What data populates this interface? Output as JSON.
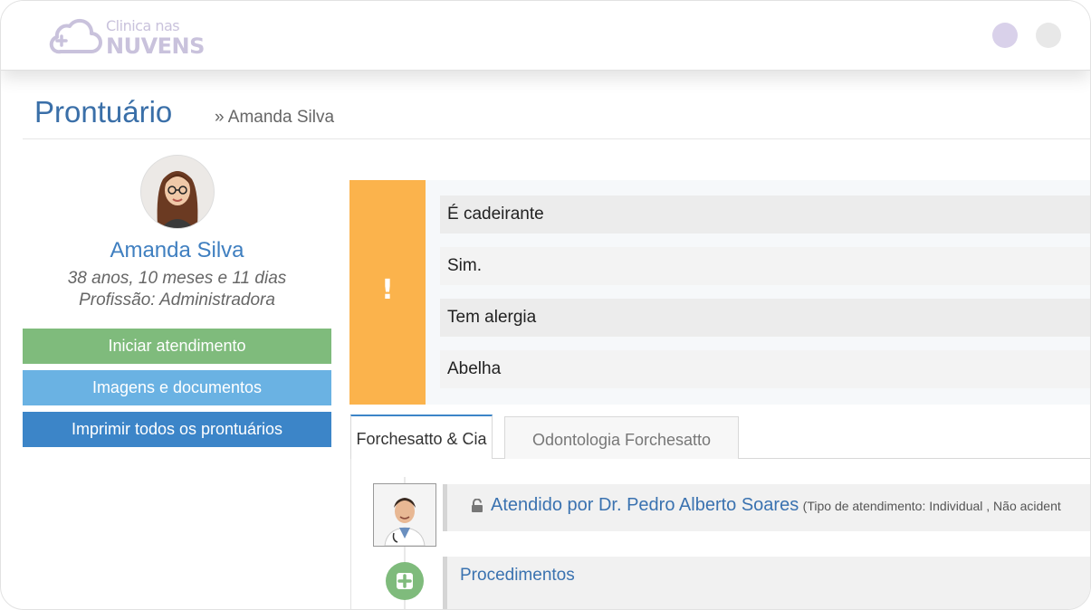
{
  "header": {
    "logo_small": "Clinica nas",
    "logo_big": "NUVENS",
    "logo_icon": "cloud-plus-icon"
  },
  "page": {
    "title": "Prontuário",
    "breadcrumb": "» Amanda Silva"
  },
  "patient": {
    "name": "Amanda Silva",
    "age": "38 anos, 10 meses e 11 dias",
    "profession": "Profissão: Administradora"
  },
  "actions": {
    "start": "Iniciar atendimento",
    "images": "Imagens e documentos",
    "print": "Imprimir todos os prontuários"
  },
  "alert": {
    "mark": "!",
    "rows": [
      "É cadeirante",
      "Sim.",
      "Tem alergia",
      "Abelha"
    ],
    "color": "#fbb34c"
  },
  "tabs": [
    {
      "label": "Forchesatto & Cia",
      "active": true
    },
    {
      "label": "Odontologia Forchesatto",
      "active": false
    }
  ],
  "timeline": {
    "attended_by": "Atendido por Dr. Pedro Alberto Soares",
    "attendance_meta": "(Tipo de atendimento: Individual , Não acident",
    "procedures": "Procedimentos"
  },
  "colors": {
    "green": "#7fbb7c",
    "light_blue": "#6ab2e3",
    "blue": "#3c85c8",
    "title_blue": "#3a6fa8"
  }
}
